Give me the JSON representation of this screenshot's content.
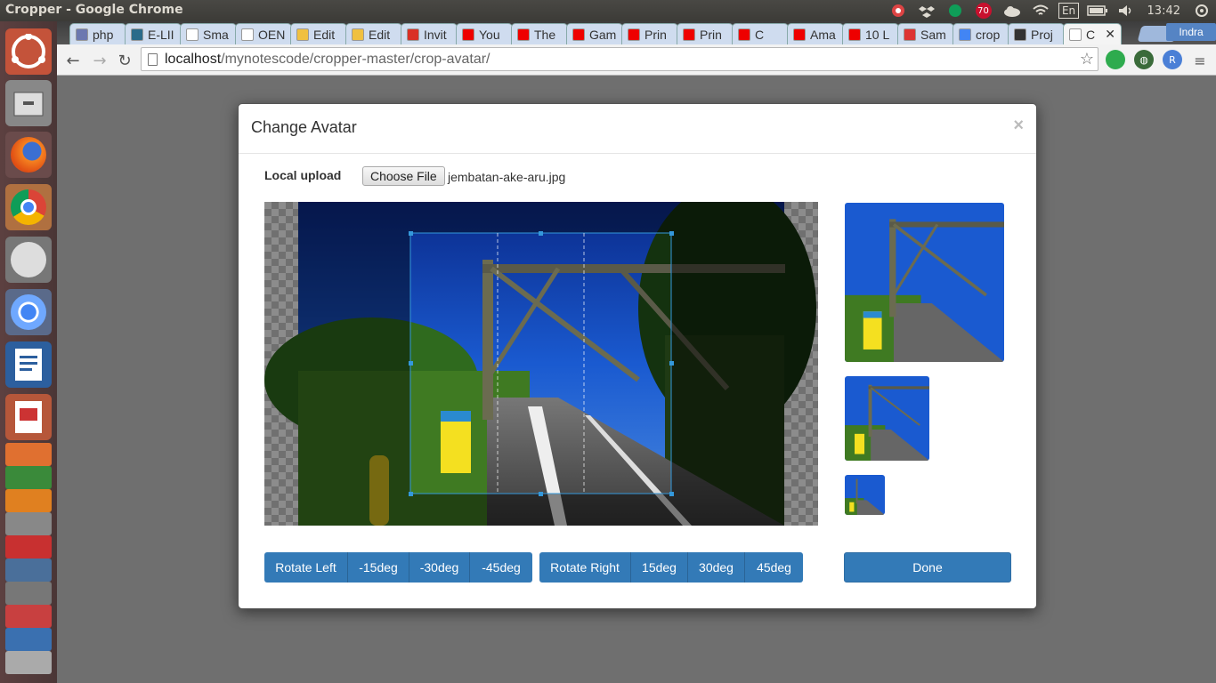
{
  "system": {
    "window_title": "Cropper - Google Chrome",
    "notification_count": "70",
    "keyboard_layout": "En",
    "clock": "13:42"
  },
  "browser": {
    "tabs": [
      {
        "label": "php",
        "favicon_color": "#6c78b0"
      },
      {
        "label": "E-LII",
        "favicon_color": "#2a6b8a"
      },
      {
        "label": "Sma",
        "favicon_color": "#ffffff"
      },
      {
        "label": "OEN",
        "favicon_color": "#ffffff"
      },
      {
        "label": "Edit",
        "favicon_color": "#f0c040"
      },
      {
        "label": "Edit",
        "favicon_color": "#f0c040"
      },
      {
        "label": "Invit",
        "favicon_color": "#d93025"
      },
      {
        "label": "You",
        "favicon_color": "#e00"
      },
      {
        "label": "The",
        "favicon_color": "#e00"
      },
      {
        "label": "Gam",
        "favicon_color": "#e00"
      },
      {
        "label": "Prin",
        "favicon_color": "#e00"
      },
      {
        "label": "Prin",
        "favicon_color": "#e00"
      },
      {
        "label": "C",
        "favicon_color": "#e00"
      },
      {
        "label": "Ama",
        "favicon_color": "#e00"
      },
      {
        "label": "10 L",
        "favicon_color": "#e00"
      },
      {
        "label": "Sam",
        "favicon_color": "#d33"
      },
      {
        "label": "crop",
        "favicon_color": "#4285f4"
      },
      {
        "label": "Proj",
        "favicon_color": "#333333"
      },
      {
        "label": "C",
        "favicon_color": "#ffffff"
      }
    ],
    "user_name": "Indra",
    "url_host": "localhost",
    "url_path": "/mynotescode/cropper-master/crop-avatar/"
  },
  "modal": {
    "title": "Change Avatar",
    "close_symbol": "×",
    "upload_label": "Local upload",
    "choose_file_label": "Choose File",
    "file_name": "jembatan-ake-aru.jpg",
    "rotate_left_group": [
      "Rotate Left",
      "-15deg",
      "-30deg",
      "-45deg"
    ],
    "rotate_right_group": [
      "Rotate Right",
      "15deg",
      "30deg",
      "45deg"
    ],
    "done_label": "Done"
  },
  "colors": {
    "primary_button": "#337ab7",
    "crop_frame": "#3498db"
  }
}
